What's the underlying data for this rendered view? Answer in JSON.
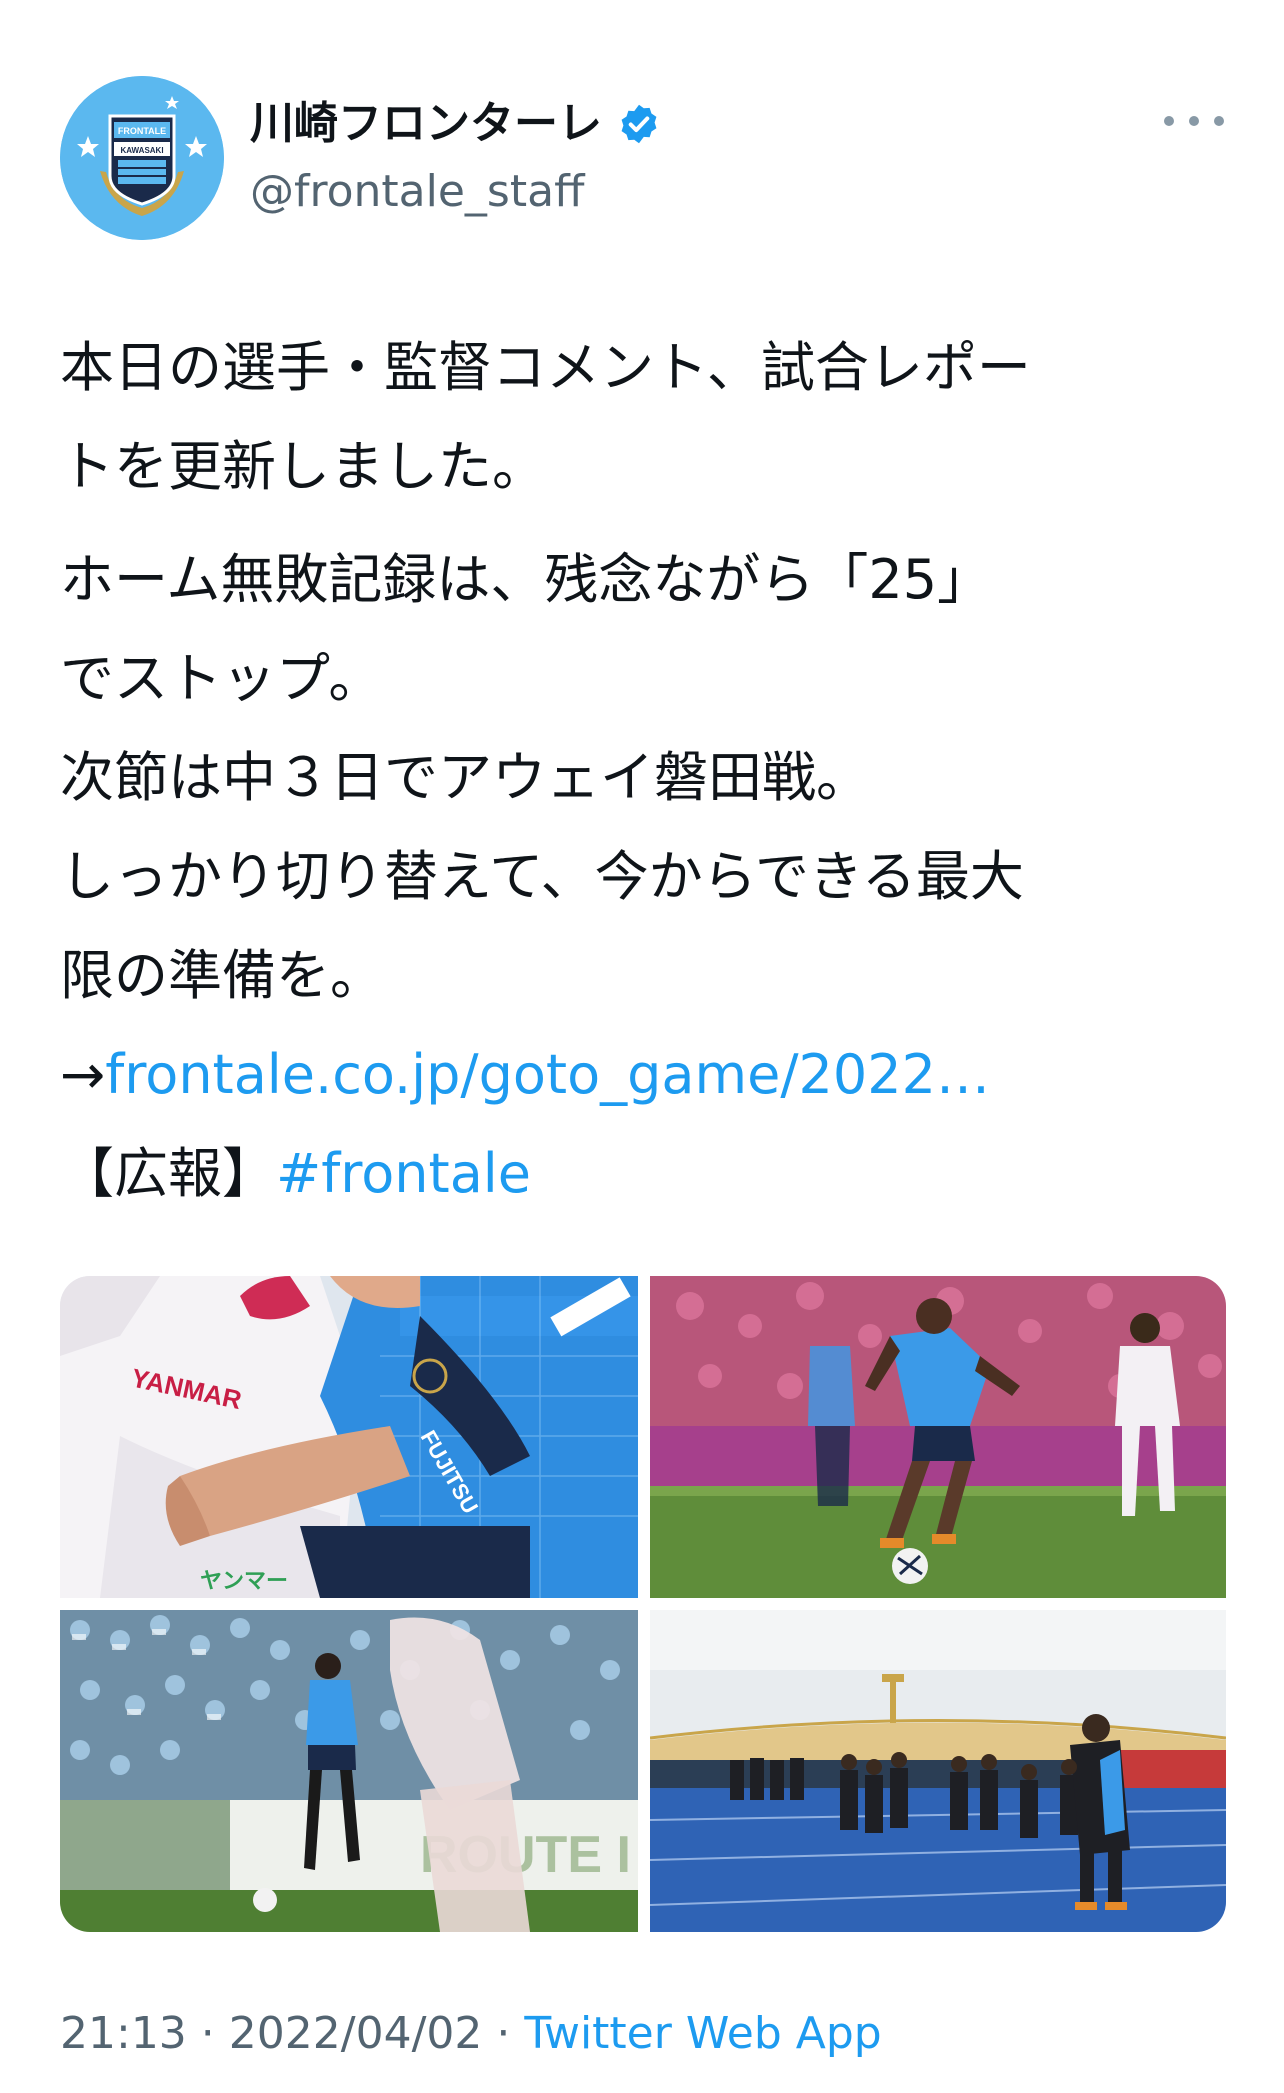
{
  "author": {
    "display_name": "川崎フロンターレ",
    "handle": "@frontale_staff",
    "verified_icon": "verified-badge-icon",
    "avatar_text_top": "FRONTALE",
    "avatar_text_mid": "KAWASAKI"
  },
  "more_icon": "more-dots-icon",
  "tweet": {
    "line1": "本日の選手・監督コメント、試合レポー",
    "line2": "トを更新しました。",
    "line3": "ホーム無敗記録は、残念ながら「25」",
    "line4": "でストップ。",
    "line5": "次節は中３日でアウェイ磐田戦。",
    "line6": "しっかり切り替えて、今からできる最大",
    "line7": "限の準備を。",
    "arrow": "→",
    "link": "frontale.co.jp/goto_game/2022…",
    "tag_prefix": "【広報】",
    "hashtag": "#frontale"
  },
  "media": {
    "photo1": "player-closeup-photo",
    "photo2": "player-dribbling-photo",
    "photo3": "player-crowd-photo",
    "photo4": "team-greeting-photo",
    "jersey_text_1": "YANMAR",
    "jersey_text_2": "FUJITSU",
    "jersey_text_3": "ヤンマー",
    "board_text": "ROUTE I"
  },
  "meta": {
    "time": "21:13",
    "separator": " · ",
    "date": "2022/04/02",
    "separator2": " · ",
    "source": "Twitter Web App"
  },
  "colors": {
    "accent": "#1d9bf0",
    "club_blue": "#5bb8ef",
    "muted": "#536471"
  }
}
